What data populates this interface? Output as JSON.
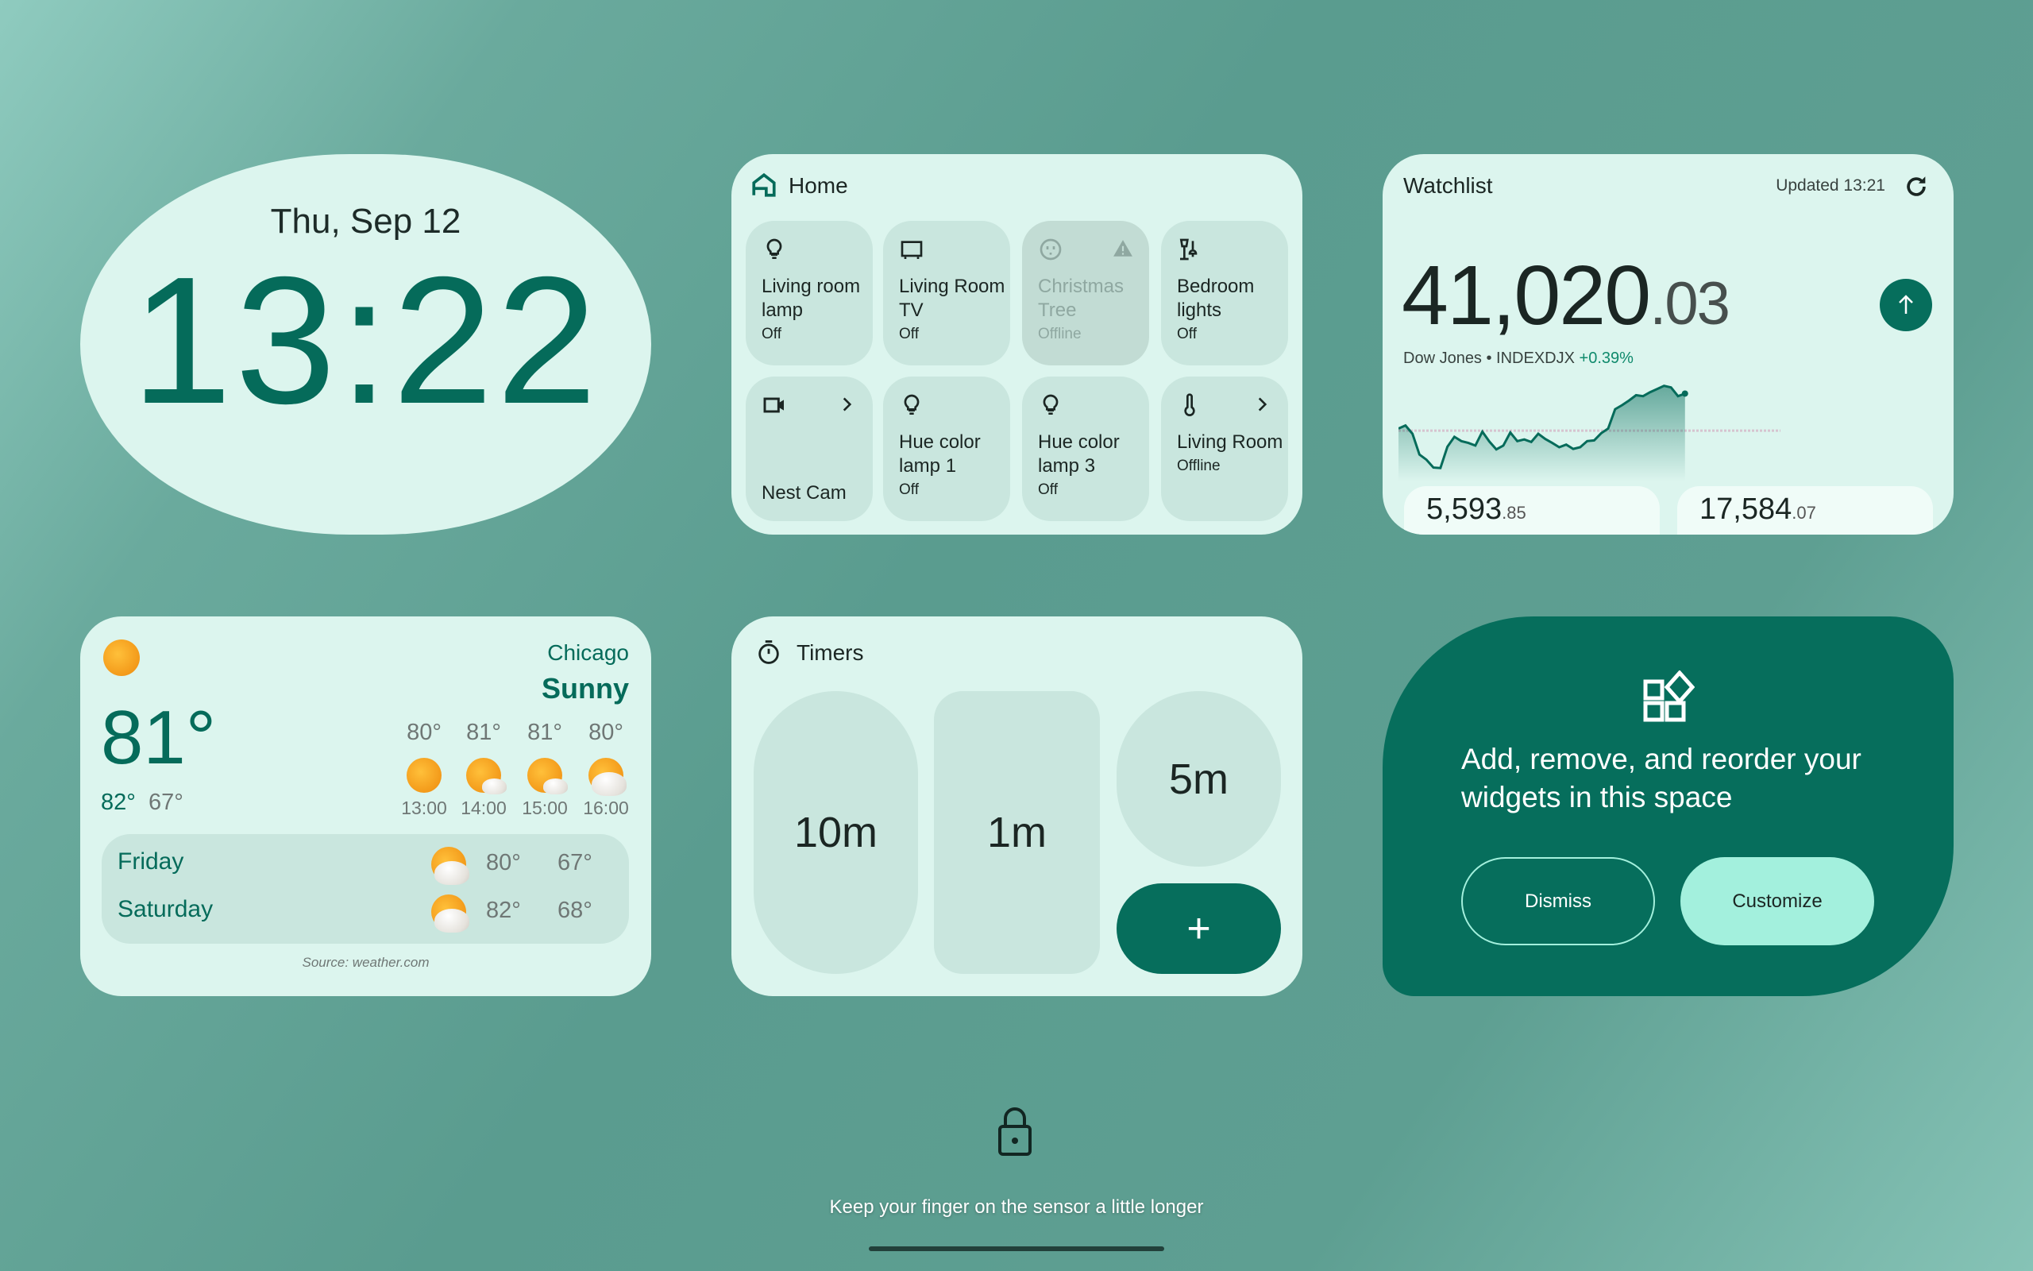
{
  "clock": {
    "date": "Thu, Sep 12",
    "time": "13:22"
  },
  "home": {
    "title": "Home",
    "tiles": [
      {
        "icon": "lightbulb-icon",
        "name": "Living room lamp",
        "status": "Off"
      },
      {
        "icon": "tv-icon",
        "name": "Living Room TV",
        "status": "Off"
      },
      {
        "icon": "outlet-icon",
        "name": "Christmas Tree",
        "status": "Offline",
        "warning": true
      },
      {
        "icon": "lamp-icon",
        "name": "Bedroom lights",
        "status": "Off"
      },
      {
        "icon": "camera-icon",
        "name": "Nest Cam",
        "status": "",
        "chevron": true
      },
      {
        "icon": "lightbulb-icon",
        "name": "Hue color lamp 1",
        "status": "Off"
      },
      {
        "icon": "lightbulb-icon",
        "name": "Hue color lamp 3",
        "status": "Off"
      },
      {
        "icon": "thermometer-icon",
        "name": "Living Room",
        "status": "Offline",
        "chevron": true
      }
    ]
  },
  "watchlist": {
    "title": "Watchlist",
    "updated": "Updated 13:21",
    "price_main": "41,020",
    "price_dec": ".03",
    "index_name": "Dow Jones • INDEXDJX",
    "change": "+0.39%",
    "others": [
      {
        "main": "5,593",
        "dec": ".85"
      },
      {
        "main": "17,584",
        "dec": ".07"
      }
    ]
  },
  "chart_data": {
    "type": "area",
    "title": "",
    "baseline": 40861,
    "values": [
      40870,
      40883,
      40848,
      40760,
      40738,
      40705,
      40703,
      40793,
      40835,
      40817,
      40809,
      40798,
      40857,
      40815,
      40782,
      40798,
      40853,
      40817,
      40824,
      40813,
      40848,
      40826,
      40809,
      40791,
      40802,
      40784,
      40791,
      40817,
      40820,
      40850,
      40870,
      40952,
      40969,
      40989,
      41011,
      41007,
      41024,
      41037,
      41051,
      41044,
      41007,
      41018
    ],
    "color": "#056b5a"
  },
  "weather": {
    "city": "Chicago",
    "condition": "Sunny",
    "temp": "81°",
    "high": "82°",
    "low": "67°",
    "hourly": [
      {
        "temp": "80°",
        "time": "13:00",
        "icon": "sunny"
      },
      {
        "temp": "81°",
        "time": "14:00",
        "icon": "mostly-sunny"
      },
      {
        "temp": "81°",
        "time": "15:00",
        "icon": "mostly-sunny"
      },
      {
        "temp": "80°",
        "time": "16:00",
        "icon": "partly-cloudy"
      }
    ],
    "daily": [
      {
        "day": "Friday",
        "high": "80°",
        "low": "67°",
        "icon": "partly-cloudy"
      },
      {
        "day": "Saturday",
        "high": "82°",
        "low": "68°",
        "icon": "partly-cloudy"
      }
    ],
    "source": "Source: weather.com"
  },
  "timers": {
    "title": "Timers",
    "presets": [
      "10m",
      "1m",
      "5m"
    ],
    "add_label": "+"
  },
  "customize": {
    "message": "Add, remove, and reorder your widgets in this space",
    "dismiss": "Dismiss",
    "customize": "Customize"
  },
  "lock": {
    "hint": "Keep your finger on the sensor a little longer"
  },
  "colors": {
    "accent": "#056b5a",
    "card": "#dcf5ee",
    "tile": "#c9e6de",
    "customize_button": "#a3f0dd"
  }
}
